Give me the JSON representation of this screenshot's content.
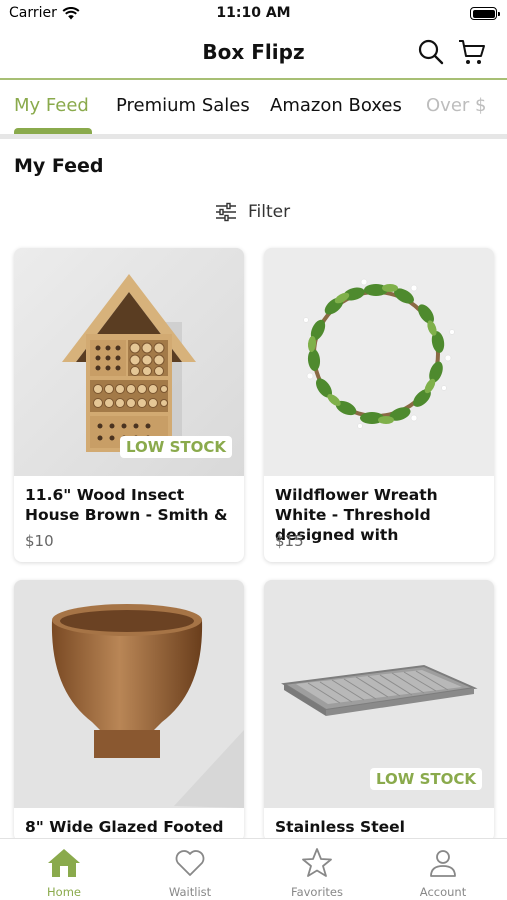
{
  "status_bar": {
    "carrier": "Carrier",
    "time": "11:10 AM"
  },
  "header": {
    "title": "Box Flipz"
  },
  "tabs": [
    {
      "label": "My Feed"
    },
    {
      "label": "Premium Sales"
    },
    {
      "label": "Amazon Boxes"
    },
    {
      "label": "Over $"
    }
  ],
  "section": {
    "title": "My Feed"
  },
  "filter": {
    "label": "Filter"
  },
  "products": [
    {
      "name": "11.6\" Wood Insect House Brown - Smith &",
      "price": "$10",
      "badge": "LOW STOCK"
    },
    {
      "name": "Wildflower Wreath White - Threshold designed with",
      "price": "$15",
      "badge": ""
    },
    {
      "name": "8\" Wide Glazed Footed",
      "price": "",
      "badge": ""
    },
    {
      "name": "Stainless Steel Barbecue",
      "price": "",
      "badge": "LOW STOCK"
    }
  ],
  "bottom_nav": [
    {
      "label": "Home",
      "icon": "home-icon",
      "active": true
    },
    {
      "label": "Waitlist",
      "icon": "heart-icon",
      "active": false
    },
    {
      "label": "Favorites",
      "icon": "star-icon",
      "active": false
    },
    {
      "label": "Account",
      "icon": "person-icon",
      "active": false
    }
  ],
  "colors": {
    "accent": "#8aaa4c",
    "header_line": "#a7bf74",
    "inactive": "#888888"
  }
}
